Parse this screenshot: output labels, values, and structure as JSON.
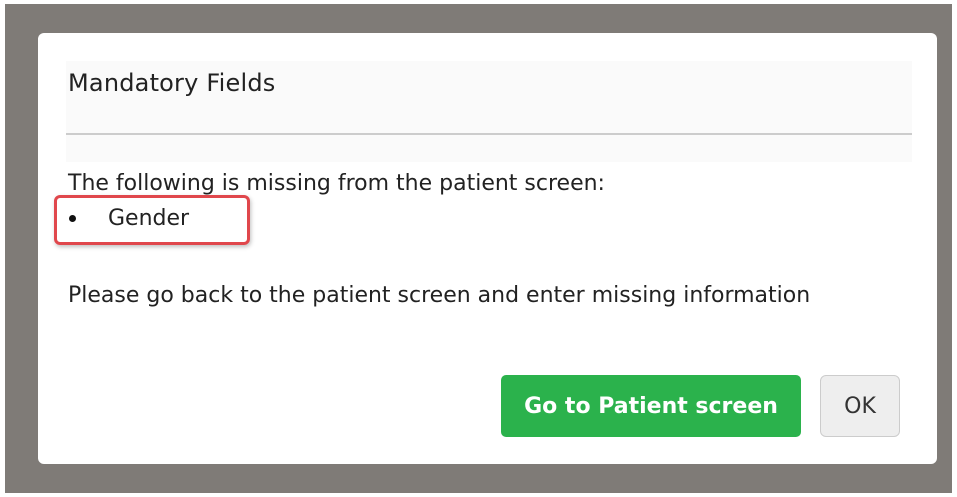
{
  "dialog": {
    "title": "Mandatory Fields",
    "intro": "The following is missing from the patient screen:",
    "missing_fields": [
      "Gender"
    ],
    "instruction": "Please go back to the patient screen and enter missing information",
    "buttons": {
      "go_to_patient": "Go to Patient screen",
      "ok": "OK"
    }
  },
  "colors": {
    "overlay": "#7f7b77",
    "primary_button": "#2bb24c",
    "highlight": "#e0474c"
  }
}
